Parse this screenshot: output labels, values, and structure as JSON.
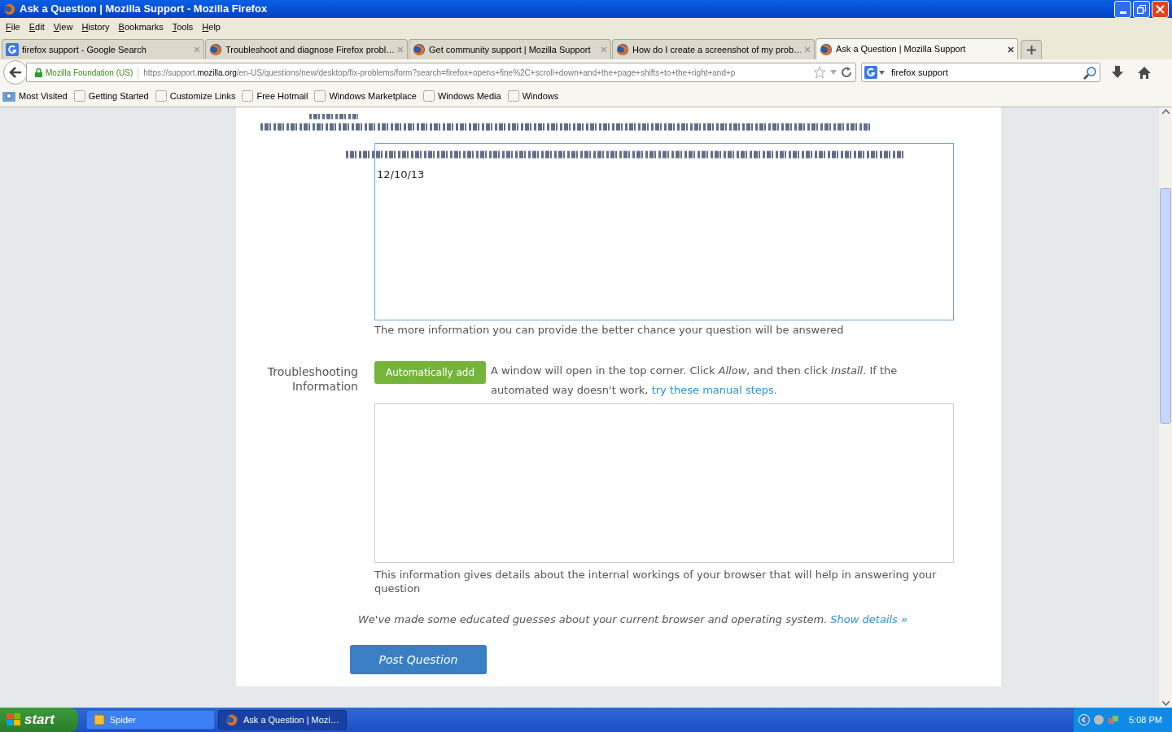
{
  "window": {
    "title": "Ask a Question | Mozilla Support - Mozilla Firefox"
  },
  "menu": [
    "File",
    "Edit",
    "View",
    "History",
    "Bookmarks",
    "Tools",
    "Help"
  ],
  "tabs": [
    {
      "label": "firefox support - Google Search",
      "kind": "google",
      "selected": false
    },
    {
      "label": "Troubleshoot and diagnose Firefox probl…",
      "kind": "firefox",
      "selected": false
    },
    {
      "label": "Get community support | Mozilla Support",
      "kind": "firefox",
      "selected": false
    },
    {
      "label": "How do I create a screenshot of my prob…",
      "kind": "firefox",
      "selected": false
    },
    {
      "label": "Ask a Question | Mozilla Support",
      "kind": "firefox",
      "selected": true
    }
  ],
  "nav": {
    "identity": "Mozilla Foundation (US)",
    "url_prefix": "https://support.",
    "url_domain": "mozilla.org",
    "url_rest": "/en-US/questions/new/desktop/fix-problems/form?search=firefox+opens+fine%2C+scroll+down+and+the+page+shifts+to+the+right+and+p",
    "search_value": "firefox support"
  },
  "bookmarks": [
    {
      "label": "Most Visited",
      "kind": "folder"
    },
    {
      "label": "Getting Started",
      "kind": "page"
    },
    {
      "label": "Customize Links",
      "kind": "page"
    },
    {
      "label": "Free Hotmail",
      "kind": "page"
    },
    {
      "label": "Windows Marketplace",
      "kind": "page"
    },
    {
      "label": "Windows Media",
      "kind": "page"
    },
    {
      "label": "Windows",
      "kind": "page"
    }
  ],
  "form": {
    "description_value": "12/10/13",
    "description_help": "The more information you can provide the better chance your question will be answered",
    "troubleshooting_label": "Troubleshooting Information",
    "auto_add_button": "Automatically add",
    "instructions": "A window will open in the top corner. Click *Allow*, and then click *Install*. If the automated way doesn't work,",
    "manual_steps_link": "try these manual steps.",
    "troubleshooting_help": "This information gives details about the internal workings of your browser that will help in answering your question",
    "guesses_text": "We've made some educated guesses about your current browser and operating system.",
    "show_details_link": "Show details »",
    "post_button": "Post Question"
  },
  "taskbar": {
    "start": "start",
    "tasks": [
      {
        "label": "Spider",
        "selected": false
      },
      {
        "label": "Ask a Question | Mozi…",
        "selected": true
      }
    ],
    "clock": "5:08 PM"
  }
}
